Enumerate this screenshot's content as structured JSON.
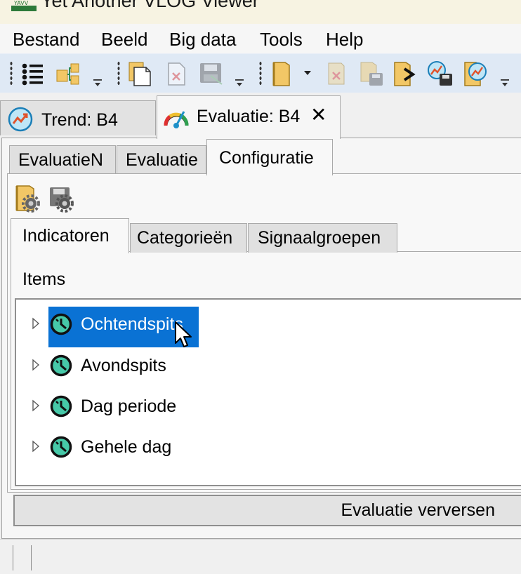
{
  "window": {
    "title": "Yet Another VLOG Viewer",
    "logo_text": "YAVV"
  },
  "menu": {
    "items": [
      "Bestand",
      "Beeld",
      "Big data",
      "Tools",
      "Help"
    ]
  },
  "toolbar": {
    "icons": [
      "list-icon",
      "tree-structure-icon",
      "new-document-icon",
      "close-document-icon",
      "save-icon",
      "open-folder-icon",
      "dropdown-arrow-icon",
      "delete-icon",
      "save-as-icon",
      "export-icon",
      "save-chart-icon",
      "open-chart-icon"
    ]
  },
  "document_tabs": [
    {
      "label": "Trend: B4",
      "icon": "trend-chart-icon",
      "active": false
    },
    {
      "label": "Evaluatie: B4",
      "icon": "gauge-icon",
      "active": true,
      "close": "✕"
    }
  ],
  "evaluation_tabs": [
    {
      "label": "EvaluatieN",
      "active": false
    },
    {
      "label": "Evaluatie",
      "active": false
    },
    {
      "label": "Configuratie",
      "active": true
    }
  ],
  "config_toolbar": {
    "icons": [
      "open-config-folder-icon",
      "save-config-icon"
    ]
  },
  "config_tabs": [
    {
      "label": "Indicatoren",
      "active": true
    },
    {
      "label": "Categorieën",
      "active": false
    },
    {
      "label": "Signaalgroepen",
      "active": false
    }
  ],
  "items_label": "Items",
  "tree_items": [
    {
      "label": "Ochtendspits",
      "selected": true
    },
    {
      "label": "Avondspits",
      "selected": false
    },
    {
      "label": "Dag periode",
      "selected": false
    },
    {
      "label": "Gehele dag",
      "selected": false
    }
  ],
  "refresh_button": {
    "label": "Evaluatie verversen"
  },
  "colors": {
    "selection": "#0a72d4",
    "toolbar": "#dfe9f5",
    "title_bar": "#f7f3e2",
    "clock": "#46c9a8"
  }
}
